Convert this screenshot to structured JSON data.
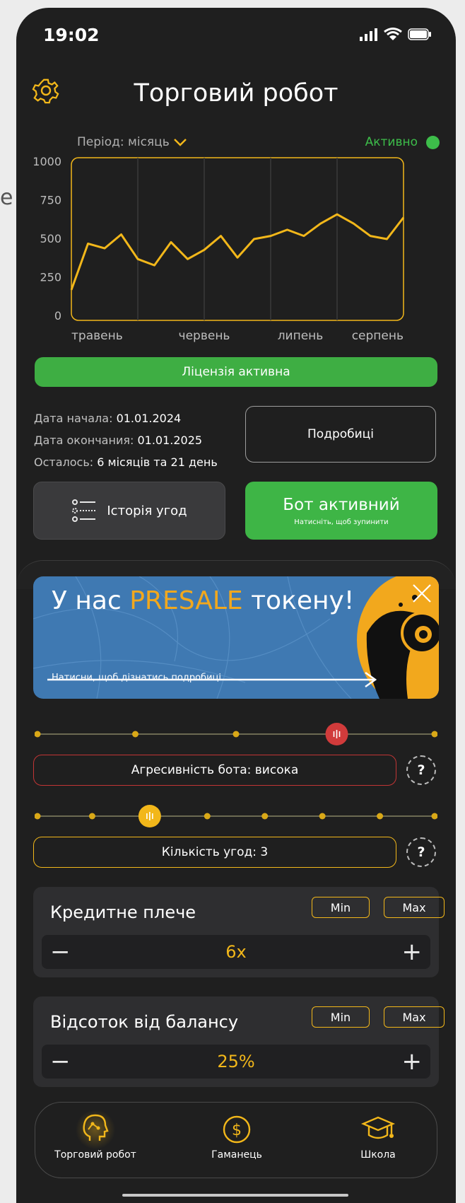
{
  "edge_fragment": "e",
  "status": {
    "time": "19:02"
  },
  "header": {
    "title": "Торговий робот"
  },
  "chart_header": {
    "period": "Період: місяць",
    "status": "Активно"
  },
  "chart_data": {
    "type": "line",
    "categories": [
      "травень",
      "червень",
      "липень",
      "серпень"
    ],
    "yticks": [
      "1000",
      "750",
      "500",
      "250",
      "0"
    ],
    "ylim": [
      0,
      1000
    ],
    "series": [
      {
        "values": [
          170,
          470,
          440,
          530,
          370,
          330,
          480,
          370,
          430,
          520,
          380,
          500,
          520,
          560,
          520,
          600,
          660,
          600,
          520,
          500,
          640
        ]
      }
    ]
  },
  "license": {
    "label": "Ліцензія активна"
  },
  "dates": {
    "start_label": "Дата начала:",
    "start": "01.01.2024",
    "end_label": "Дата окончания:",
    "end": "01.01.2025",
    "left_label": "Осталось:",
    "left": "6 місяців та 21 день"
  },
  "buttons": {
    "details": "Подробиці",
    "history": "Історія угод",
    "bot_main": "Бот активний",
    "bot_sub": "Натисніть, щоб зупинити"
  },
  "banner": {
    "prefix": "У нас ",
    "highlight": "PRESALE",
    "suffix": " токену!",
    "sub": "Натисни, щоб дізнатись подробиці"
  },
  "aggressiveness": {
    "label": "Агресивність бота: висока",
    "steps": 5,
    "selected": 4,
    "color": "#d13b3b"
  },
  "deals": {
    "label": "Кількість угод: 3",
    "steps": 8,
    "selected": 3,
    "color": "#f2b71a"
  },
  "help": "?",
  "leverage": {
    "title": "Кредитне плече",
    "min": "Min",
    "max": "Max",
    "value": "6x",
    "minus": "−",
    "plus": "+"
  },
  "percent": {
    "title": "Відсоток від балансу",
    "min": "Min",
    "max": "Max",
    "value": "25%",
    "minus": "−",
    "plus": "+"
  },
  "tabs": [
    {
      "label": "Торговий робот",
      "icon": "robot-head-icon"
    },
    {
      "label": "Гаманець",
      "icon": "dollar-coin-icon"
    },
    {
      "label": "Школа",
      "icon": "graduation-cap-icon"
    }
  ],
  "colors": {
    "accent": "#f2b71a",
    "green": "#3eae43",
    "danger": "#d13b3b",
    "banner": "#3f79b2"
  }
}
